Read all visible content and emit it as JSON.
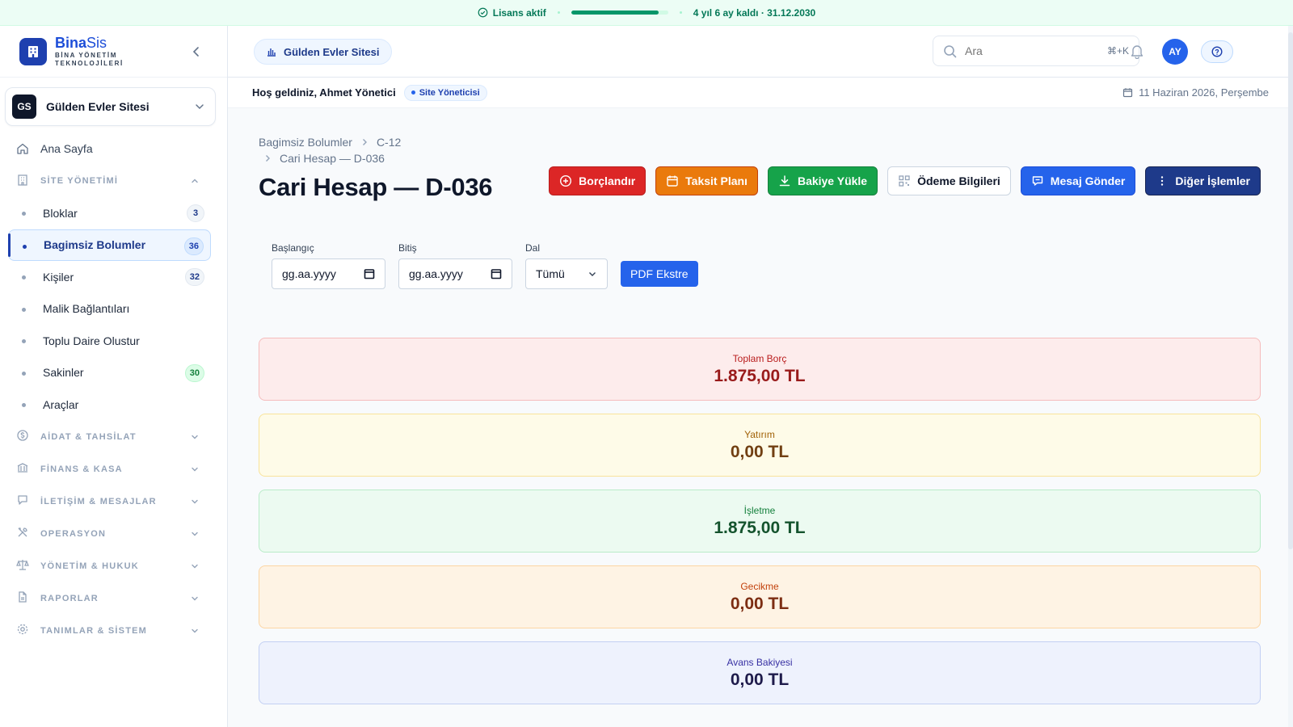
{
  "license": {
    "status": "Lisans aktif",
    "progress": 0.9,
    "remaining": "4 yıl 6 ay kaldı · 31.12.2030",
    "accent": "#059669"
  },
  "brand": {
    "name_bold": "Bina",
    "name_light": "Sis",
    "subtitle_line1": "BİNA YÖNETİM",
    "subtitle_line2": "TEKNOLOJİLERİ"
  },
  "site_selector": {
    "initials": "GS",
    "name": "Gülden Evler Sitesi"
  },
  "nav": {
    "home": "Ana Sayfa",
    "site_section": "SİTE YÖNETİMİ",
    "sub_items": [
      {
        "label": "Bloklar",
        "count": "3"
      },
      {
        "label": "Bagimsiz Bolumler",
        "count": "36"
      },
      {
        "label": "Kişiler",
        "count": "32"
      },
      {
        "label": "Malik Bağlantıları",
        "count": ""
      },
      {
        "label": "Toplu Daire Olustur",
        "count": ""
      },
      {
        "label": "Sakinler",
        "count": "30"
      },
      {
        "label": "Araçlar",
        "count": ""
      }
    ],
    "sections": [
      "AİDAT & TAHSİLAT",
      "FİNANS & KASA",
      "İLETİŞİM & MESAJLAR",
      "OPERASYON",
      "YÖNETİM & HUKUK",
      "RAPORLAR",
      "TANIMLAR & SİSTEM"
    ]
  },
  "topbar": {
    "site_chip": "Gülden Evler Sitesi",
    "search_placeholder": "Ara",
    "shortcut": "⌘+K",
    "avatar_initials": "AY"
  },
  "welcome": {
    "greeting": "Hoş geldiniz, Ahmet Yönetici",
    "role": "Site Yöneticisi",
    "date": "11 Haziran 2026, Perşembe"
  },
  "breadcrumb": {
    "items": [
      "Bagimsiz Bolumler",
      "C-12",
      "Cari Hesap — D-036"
    ]
  },
  "page": {
    "title": "Cari Hesap — D-036"
  },
  "actions": {
    "charge": "Borçlandır",
    "installment": "Taksit Planı",
    "load_balance": "Bakiye Yükle",
    "payment_info": "Ödeme Bilgileri",
    "send_message": "Mesaj Gönder",
    "other": "Diğer İşlemler"
  },
  "filters": {
    "start_label": "Başlangıç",
    "start_value": "gg.aa.yyyy",
    "end_label": "Bitiş",
    "end_value": "gg.aa.yyyy",
    "branch_label": "Dal",
    "branch_value": "Tümü",
    "pdf_button": "PDF Ekstre"
  },
  "summary": {
    "total_debt_label": "Toplam Borç",
    "total_debt_value": "1.875,00 TL",
    "investment_label": "Yatırım",
    "investment_value": "0,00 TL",
    "operation_label": "İşletme",
    "operation_value": "1.875,00 TL",
    "late_label": "Gecikme",
    "late_value": "0,00 TL",
    "advance_label": "Avans Bakiyesi",
    "advance_value": "0,00 TL"
  }
}
